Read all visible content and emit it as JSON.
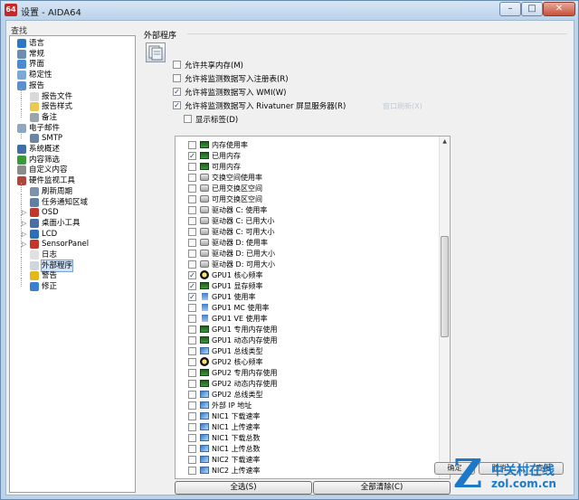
{
  "window": {
    "icon_text": "64",
    "title": "设置 - AIDA64"
  },
  "sidebar": {
    "search_label": "查找",
    "items": [
      {
        "label": "语言",
        "icon": "globe-icon",
        "color": "#2b79c6",
        "depth": 0
      },
      {
        "label": "常规",
        "icon": "settings-icon",
        "color": "#6d8db3",
        "depth": 0
      },
      {
        "label": "界面",
        "icon": "window-icon",
        "color": "#4b8bd6",
        "depth": 0
      },
      {
        "label": "稳定性",
        "icon": "stability-icon",
        "color": "#7aa9d9",
        "depth": 0
      },
      {
        "label": "报告",
        "icon": "report-icon",
        "color": "#5c8fcf",
        "depth": 0
      },
      {
        "label": "报告文件",
        "icon": "file-icon",
        "color": "#d9d9d9",
        "depth": 1
      },
      {
        "label": "报告样式",
        "icon": "style-icon",
        "color": "#e9c94e",
        "depth": 1
      },
      {
        "label": "备注",
        "icon": "note-icon",
        "color": "#9aa4ad",
        "depth": 1
      },
      {
        "label": "电子邮件",
        "icon": "email-icon",
        "color": "#8ea7c2",
        "depth": 0
      },
      {
        "label": "SMTP",
        "icon": "smtp-icon",
        "color": "#6a86a5",
        "depth": 1
      },
      {
        "label": "系统概述",
        "icon": "summary-icon",
        "color": "#3f6ea8",
        "depth": 0
      },
      {
        "label": "内容筛选",
        "icon": "filter-icon",
        "color": "#3a9a3a",
        "depth": 0
      },
      {
        "label": "自定义内容",
        "icon": "custom-icon",
        "color": "#8b8b8b",
        "depth": 0
      },
      {
        "label": "硬件监视工具",
        "icon": "monitor-icon",
        "color": "#b0463a",
        "depth": 0
      },
      {
        "label": "刷新周期",
        "icon": "refresh-icon",
        "color": "#7d93ab",
        "depth": 1
      },
      {
        "label": "任务通知区域",
        "icon": "tray-icon",
        "color": "#5e7fa6",
        "depth": 1
      },
      {
        "label": "OSD",
        "icon": "osd-icon",
        "color": "#c0392b",
        "depth": 1
      },
      {
        "label": "桌面小工具",
        "icon": "gadget-icon",
        "color": "#4a6fa5",
        "depth": 1
      },
      {
        "label": "LCD",
        "icon": "lcd-icon",
        "color": "#2c6eb8",
        "depth": 1
      },
      {
        "label": "SensorPanel",
        "icon": "sensorpanel-icon",
        "color": "#c0392b",
        "depth": 1
      },
      {
        "label": "日志",
        "icon": "log-icon",
        "color": "#e0e0e0",
        "depth": 1
      },
      {
        "label": "外部程序",
        "icon": "external-app-icon",
        "color": "#cfd6dd",
        "depth": 1
      },
      {
        "label": "警告",
        "icon": "warning-icon",
        "color": "#e5b719",
        "depth": 1
      },
      {
        "label": "修正",
        "icon": "correction-icon",
        "color": "#3b7fd2",
        "depth": 1
      }
    ],
    "selected": "外部程序"
  },
  "panel": {
    "section_title": "外部程序",
    "section_icon": "external-app-icon",
    "options": [
      {
        "label": "允许共享内存(M)",
        "checked": false
      },
      {
        "label": "允许将监测数据写入注册表(R)",
        "checked": false
      },
      {
        "label": "允许将监测数据写入 WMI(W)",
        "checked": true
      },
      {
        "label": "允许将监测数据写入 Rivatuner 屏显服务器(R)",
        "checked": true
      },
      {
        "label": "显示标签(D)",
        "checked": false
      }
    ],
    "ghost_text": "窗口刷新(X)",
    "sensor_list": [
      {
        "label": "内存使用率",
        "checked": false,
        "icon": "memory-icon"
      },
      {
        "label": "已用内存",
        "checked": true,
        "icon": "memory-icon"
      },
      {
        "label": "可用内存",
        "checked": false,
        "icon": "memory-icon"
      },
      {
        "label": "交换空间使用率",
        "checked": false,
        "icon": "disk-icon"
      },
      {
        "label": "已用交换区空间",
        "checked": false,
        "icon": "disk-icon"
      },
      {
        "label": "可用交换区空间",
        "checked": false,
        "icon": "disk-icon"
      },
      {
        "label": "驱动器 C: 使用率",
        "checked": false,
        "icon": "disk-icon"
      },
      {
        "label": "驱动器 C: 已用大小",
        "checked": false,
        "icon": "disk-icon"
      },
      {
        "label": "驱动器 C: 可用大小",
        "checked": false,
        "icon": "disk-icon"
      },
      {
        "label": "驱动器 D: 使用率",
        "checked": false,
        "icon": "disk-icon"
      },
      {
        "label": "驱动器 D: 已用大小",
        "checked": false,
        "icon": "disk-icon"
      },
      {
        "label": "驱动器 D: 可用大小",
        "checked": false,
        "icon": "disk-icon"
      },
      {
        "label": "GPU1 核心频率",
        "checked": true,
        "icon": "gpu-icon"
      },
      {
        "label": "GPU1 显存频率",
        "checked": true,
        "icon": "memory-icon"
      },
      {
        "label": "GPU1 使用率",
        "checked": true,
        "icon": "hourglass-icon"
      },
      {
        "label": "GPU1 MC 使用率",
        "checked": false,
        "icon": "hourglass-icon"
      },
      {
        "label": "GPU1 VE 使用率",
        "checked": false,
        "icon": "hourglass-icon"
      },
      {
        "label": "GPU1 专用内存使用",
        "checked": false,
        "icon": "memory-icon"
      },
      {
        "label": "GPU1 动态内存使用",
        "checked": false,
        "icon": "memory-icon"
      },
      {
        "label": "GPU1 总线类型",
        "checked": false,
        "icon": "bus-icon"
      },
      {
        "label": "GPU2 核心频率",
        "checked": false,
        "icon": "gpu-icon"
      },
      {
        "label": "GPU2 专用内存使用",
        "checked": false,
        "icon": "memory-icon"
      },
      {
        "label": "GPU2 动态内存使用",
        "checked": false,
        "icon": "memory-icon"
      },
      {
        "label": "GPU2 总线类型",
        "checked": false,
        "icon": "bus-icon"
      },
      {
        "label": "外部 IP 地址",
        "checked": false,
        "icon": "network-icon"
      },
      {
        "label": "NIC1 下载速率",
        "checked": false,
        "icon": "network-icon"
      },
      {
        "label": "NIC1 上传速率",
        "checked": false,
        "icon": "network-icon"
      },
      {
        "label": "NIC1 下载总数",
        "checked": false,
        "icon": "network-icon"
      },
      {
        "label": "NIC1 上传总数",
        "checked": false,
        "icon": "network-icon"
      },
      {
        "label": "NIC2 下载速率",
        "checked": false,
        "icon": "network-icon"
      },
      {
        "label": "NIC2 上传速率",
        "checked": false,
        "icon": "network-icon"
      }
    ],
    "select_all_label": "全选(S)",
    "clear_all_label": "全部清除(C)"
  },
  "footer": {
    "buttons": [
      "确定",
      "取消",
      "应用"
    ]
  },
  "watermark": {
    "line1": "中关村在线",
    "line2": "zol.com.cn",
    "color": "#1d78c8"
  }
}
